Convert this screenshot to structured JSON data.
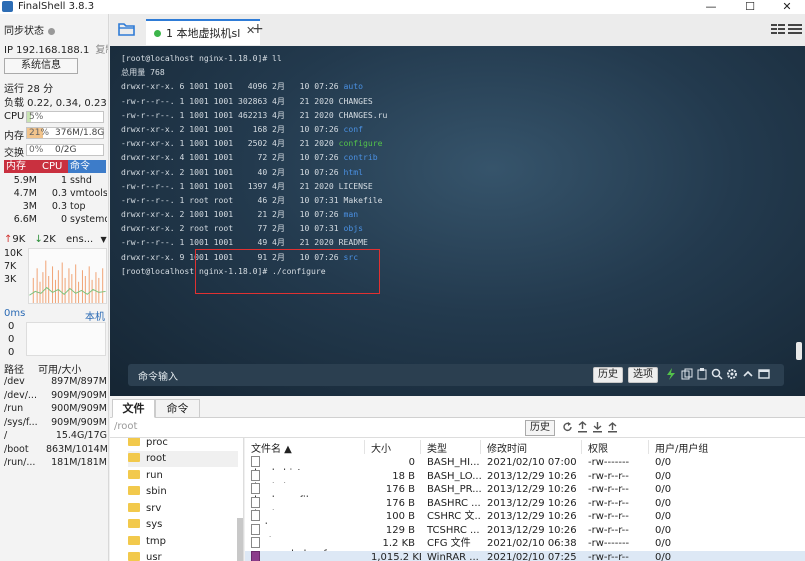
{
  "window": {
    "title": "FinalShell 3.8.3",
    "minimize": "—",
    "maximize": "☐",
    "close": "✕"
  },
  "sidebar": {
    "sync_status": "同步状态",
    "ip_label": "IP 192.168.188.1",
    "copy_label": "复制",
    "sysinfo_button": "系统信息",
    "uptime": "运行 28 分",
    "load": "负载 0.22, 0.34, 0.23",
    "cpu": {
      "label": "CPU",
      "text": "5%",
      "fraction": 0.05
    },
    "mem": {
      "label": "内存",
      "text": "21%",
      "detail": "376M/1.8G",
      "fraction": 0.21
    },
    "swap": {
      "label": "交换",
      "text": "0%",
      "detail": "0/2G",
      "fraction": 0
    },
    "proc_headers": [
      "内存",
      "CPU",
      "命令"
    ],
    "processes": [
      {
        "mem": "5.9M",
        "cpu": "1",
        "cmd": "sshd"
      },
      {
        "mem": "4.7M",
        "cpu": "0.3",
        "cmd": "vmtools"
      },
      {
        "mem": "3M",
        "cpu": "0.3",
        "cmd": "top"
      },
      {
        "mem": "6.6M",
        "cpu": "0",
        "cmd": "systemd"
      }
    ],
    "net": {
      "up": "9K",
      "down": "2K",
      "iface": "ens...",
      "axis": [
        "10K",
        "7K",
        "3K"
      ]
    },
    "ping": {
      "label": "0ms",
      "host": "本机",
      "values": [
        "0",
        "0",
        "0"
      ]
    },
    "disk_headers": [
      "路径",
      "可用/大小"
    ],
    "disks": [
      {
        "path": "/dev",
        "size": "897M/897M"
      },
      {
        "path": "/dev/...",
        "size": "909M/909M"
      },
      {
        "path": "/run",
        "size": "900M/909M"
      },
      {
        "path": "/sys/f...",
        "size": "909M/909M"
      },
      {
        "path": "/",
        "size": "15.4G/17G"
      },
      {
        "path": "/boot",
        "size": "863M/1014M"
      },
      {
        "path": "/run/...",
        "size": "181M/181M"
      }
    ]
  },
  "tabs": {
    "session": "1 本地虚拟机sl",
    "add": "+"
  },
  "terminal": {
    "lines": [
      {
        "text": "[root@localhost nginx-1.18.0]# ll",
        "name": ""
      },
      {
        "text": "总用量 768",
        "name": ""
      },
      {
        "text": "drwxr-xr-x. 6 1001 1001   4096 2月   10 07:26 ",
        "name": "auto",
        "color": "blue"
      },
      {
        "text": "-rw-r--r--. 1 1001 1001 302863 4月   21 2020 ",
        "name": "CHANGES",
        "color": ""
      },
      {
        "text": "-rw-r--r--. 1 1001 1001 462213 4月   21 2020 ",
        "name": "CHANGES.ru",
        "color": ""
      },
      {
        "text": "drwxr-xr-x. 2 1001 1001    168 2月   10 07:26 ",
        "name": "conf",
        "color": "blue"
      },
      {
        "text": "-rwxr-xr-x. 1 1001 1001   2502 4月   21 2020 ",
        "name": "configure",
        "color": "green"
      },
      {
        "text": "drwxr-xr-x. 4 1001 1001     72 2月   10 07:26 ",
        "name": "contrib",
        "color": "blue"
      },
      {
        "text": "drwxr-xr-x. 2 1001 1001     40 2月   10 07:26 ",
        "name": "html",
        "color": "blue"
      },
      {
        "text": "-rw-r--r--. 1 1001 1001   1397 4月   21 2020 ",
        "name": "LICENSE",
        "color": ""
      },
      {
        "text": "-rw-r--r--. 1 root root     46 2月   10 07:31 ",
        "name": "Makefile",
        "color": ""
      },
      {
        "text": "drwxr-xr-x. 2 1001 1001     21 2月   10 07:26 ",
        "name": "man",
        "color": "blue"
      },
      {
        "text": "drwxr-xr-x. 2 root root     77 2月   10 07:31 ",
        "name": "objs",
        "color": "blue"
      },
      {
        "text": "-rw-r--r--. 1 1001 1001     49 4月   21 2020 ",
        "name": "README",
        "color": ""
      },
      {
        "text": "drwxr-xr-x. 9 1001 1001     91 2月   10 07:26 ",
        "name": "src",
        "color": "blue"
      },
      {
        "text": "[root@localhost nginx-1.18.0]# ./configure",
        "name": ""
      }
    ],
    "cmd_label": "命令输入",
    "history_btn": "历史",
    "options_btn": "选项"
  },
  "file_panel": {
    "tabs": [
      "文件",
      "命令"
    ],
    "path": "/root",
    "history_btn": "历史",
    "tree": [
      {
        "label": "proc",
        "selected": false
      },
      {
        "label": "root",
        "selected": true
      },
      {
        "label": "run",
        "selected": false
      },
      {
        "label": "sbin",
        "selected": false
      },
      {
        "label": "srv",
        "selected": false
      },
      {
        "label": "sys",
        "selected": false
      },
      {
        "label": "tmp",
        "selected": false
      },
      {
        "label": "usr",
        "selected": false
      }
    ],
    "headers": [
      "文件名 ▲",
      "大小",
      "类型",
      "修改时间",
      "权限",
      "用户/用户组"
    ],
    "files": [
      {
        "name": ".bash_history",
        "size": "0",
        "type": "BASH_HI...",
        "mtime": "2021/02/10 07:00",
        "perm": "-rw-------",
        "owner": "0/0",
        "icon": "doc"
      },
      {
        "name": ".bash_logout",
        "size": "18 B",
        "type": "BASH_LO...",
        "mtime": "2013/12/29 10:26",
        "perm": "-rw-r--r--",
        "owner": "0/0",
        "icon": "doc"
      },
      {
        "name": ".bash_profile",
        "size": "176 B",
        "type": "BASH_PR...",
        "mtime": "2013/12/29 10:26",
        "perm": "-rw-r--r--",
        "owner": "0/0",
        "icon": "doc"
      },
      {
        "name": ".bashrc",
        "size": "176 B",
        "type": "BASHRC ...",
        "mtime": "2013/12/29 10:26",
        "perm": "-rw-r--r--",
        "owner": "0/0",
        "icon": "doc"
      },
      {
        "name": ".cshrc",
        "size": "100 B",
        "type": "CSHRC 文...",
        "mtime": "2013/12/29 10:26",
        "perm": "-rw-r--r--",
        "owner": "0/0",
        "icon": "doc"
      },
      {
        "name": ".tcshrc",
        "size": "129 B",
        "type": "TCSHRC ...",
        "mtime": "2013/12/29 10:26",
        "perm": "-rw-r--r--",
        "owner": "0/0",
        "icon": "doc"
      },
      {
        "name": "anaconda-ks.cfg",
        "size": "1.2 KB",
        "type": "CFG 文件",
        "mtime": "2021/02/10 06:38",
        "perm": "-rw-------",
        "owner": "0/0",
        "icon": "doc"
      },
      {
        "name": "nginx-1.18.0.tar.gz",
        "size": "1,015.2 KB",
        "type": "WinRAR ...",
        "mtime": "2021/02/10 07:25",
        "perm": "-rw-r--r--",
        "owner": "0/0",
        "icon": "rar"
      }
    ]
  },
  "colors": {
    "accent": "#2e7bd6",
    "proc_header": "#c9303f",
    "cpu_header": "#c9303f",
    "terminal_bg": "#233a4e",
    "dir": "#4a90e2",
    "exec": "#53c24a",
    "highlight": "#e03131"
  }
}
